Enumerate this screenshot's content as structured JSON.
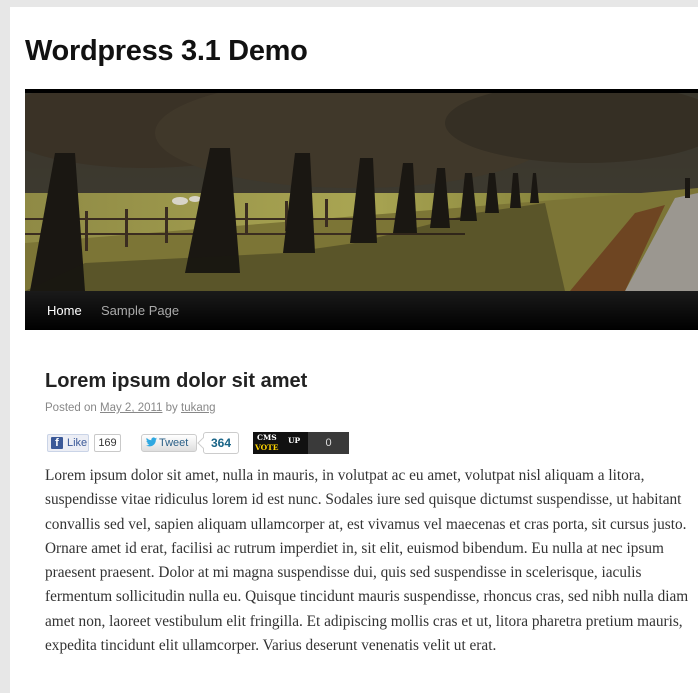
{
  "site": {
    "title": "Wordpress 3.1 Demo"
  },
  "nav": {
    "items": [
      {
        "label": "Home"
      },
      {
        "label": "Sample Page"
      }
    ]
  },
  "post": {
    "title": "Lorem ipsum dolor sit amet",
    "posted_on_label": "Posted on",
    "date": "May 2, 2011",
    "by_label": "by",
    "author": "tukang",
    "body": "Lorem ipsum dolor sit amet, nulla in mauris, in volutpat ac eu amet, volutpat nisl aliquam a litora, suspendisse vitae ridiculus lorem id est nunc. Sodales iure sed quisque dictumst suspendisse, ut habitant convallis sed vel, sapien aliquam ullamcorper at, est vivamus vel maecenas et cras porta, sit cursus justo. Ornare amet id erat, facilisi ac rutrum imperdiet in, sit elit, euismod bibendum. Eu nulla at nec ipsum praesent praesent. Dolor at mi magna suspendisse dui, quis sed suspendisse in scelerisque, iaculis fermentum sollicitudin nulla eu. Quisque tincidunt mauris suspendisse, rhoncus cras, sed nibh nulla diam amet non, laoreet vestibulum elit fringilla. Et adipiscing mollis cras et ut, litora pharetra pretium mauris, expedita tincidunt elit ullamcorper. Varius deserunt venenatis velit ut erat."
  },
  "share": {
    "facebook": {
      "icon": "facebook-icon",
      "label": "Like",
      "count": "169"
    },
    "twitter": {
      "icon": "twitter-bird-icon",
      "label": "Tweet",
      "count": "364"
    },
    "cms_vote": {
      "top": "CMS",
      "vote": "VOTE",
      "up": "UP",
      "count": "0"
    }
  },
  "colors": {
    "nav_background": "#000000",
    "title_text": "#111111",
    "meta_text": "#888888",
    "facebook_blue": "#3b5998",
    "cms_vote_yellow": "#ffd600"
  }
}
